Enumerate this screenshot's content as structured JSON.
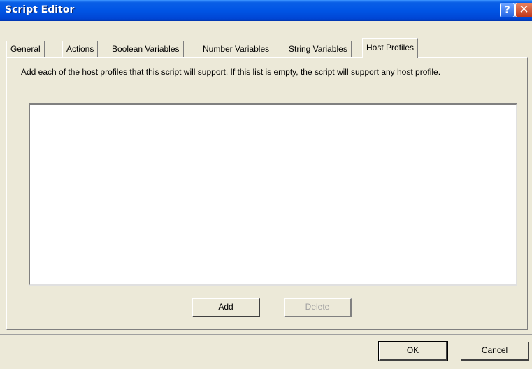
{
  "window": {
    "title": "Script Editor"
  },
  "titlebar_buttons": {
    "help": "?",
    "close": "✕"
  },
  "tabs": [
    {
      "label": "General"
    },
    {
      "label": "Actions"
    },
    {
      "label": "Boolean Variables"
    },
    {
      "label": "Number Variables"
    },
    {
      "label": "String Variables"
    },
    {
      "label": "Host Profiles",
      "active": true
    }
  ],
  "host_profiles": {
    "description": "Add each of the host profiles that this script will support.  If this list is empty, the script will support any host profile.",
    "items": [],
    "add_button": "Add",
    "delete_button": "Delete"
  },
  "footer": {
    "ok_button": "OK",
    "cancel_button": "Cancel"
  }
}
